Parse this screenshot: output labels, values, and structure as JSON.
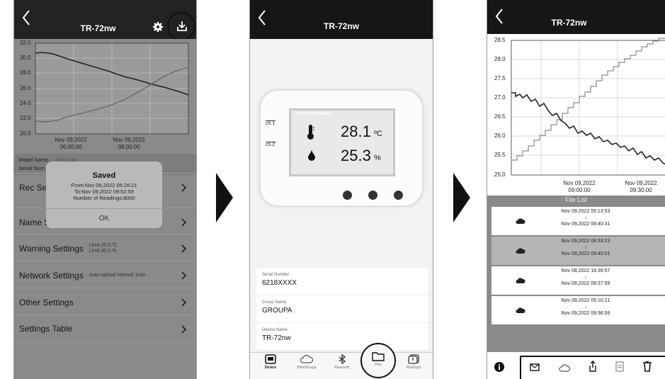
{
  "panel1": {
    "title": "TR-72nw",
    "icons": {
      "back": "chevron-left-icon",
      "settings": "gear-icon",
      "download": "download-icon"
    },
    "y_ticks": [
      "32.0",
      "30.0",
      "28.0",
      "26.0",
      "24.0",
      "22.0",
      "20.0"
    ],
    "x_labels": [
      {
        "date": "Nov 09,2022",
        "time": "06:00:00"
      },
      {
        "date": "Nov 09,2022",
        "time": "08:00:00"
      }
    ],
    "model_name_label": "Model Name",
    "model_name_value": "TR-72nw",
    "serial_label": "Serial Num",
    "dialog": {
      "title": "Saved",
      "line1": "From:Nov 09,2022 05:26:21",
      "line2": "To:Nov 09,2022 09:52:59",
      "line3": "Number of Readings:8000",
      "ok": "OK"
    },
    "settings": [
      {
        "label": "Rec Sett",
        "sub1": "",
        "sub2": ""
      },
      {
        "label": "Name Se",
        "sub1": "",
        "sub2": ""
      },
      {
        "label": "Warning Settings",
        "sub1": "Limit:20.0 ºC",
        "sub2": "Limit:30.0 %"
      },
      {
        "label": "Network Settings",
        "sub1": "Auto-upload Interval 1min",
        "sub2": ""
      },
      {
        "label": "Other Settings",
        "sub1": "",
        "sub2": ""
      },
      {
        "label": "Settings Table",
        "sub1": "",
        "sub2": ""
      }
    ]
  },
  "panel2": {
    "title": "TR-72nw",
    "device_brand": "Thermo Recorder",
    "ch1": "ch.1",
    "ch2": "ch.2",
    "temp_value": "28.1",
    "temp_unit": "ºC",
    "hum_value": "25.3",
    "hum_unit": "%",
    "fields": [
      {
        "label": "Serial Number",
        "value": "6218XXXX"
      },
      {
        "label": "Group Name",
        "value": "GROUPA"
      },
      {
        "label": "Device Name",
        "value": "TR-72nw"
      }
    ],
    "tabs": [
      "Device",
      "WebStorage",
      "Bluetooth",
      "Files",
      "Warnings"
    ]
  },
  "panel3": {
    "title": "TR-72nw",
    "y_ticks": [
      "28.5",
      "28.0",
      "27.5",
      "27.0",
      "26.5",
      "26.0",
      "25.5",
      "25.0"
    ],
    "x_labels": [
      {
        "date": "Nov 09,2022",
        "time": "09:00:00"
      },
      {
        "date": "Nov 09,2022",
        "time": "09:30:00"
      }
    ],
    "file_list_title": "File List",
    "arrow": "↓",
    "files": [
      {
        "from": "Nov 09,2022 05:13:53",
        "to": "Nov 09,2022 09:40:31",
        "selected": false
      },
      {
        "from": "Nov 09,2022 08:33:23",
        "to": "Nov 09,2022 09:40:01",
        "selected": true
      },
      {
        "from": "Nov 08,2022 16:39:57",
        "to": "Nov 09,2022 09:37:59",
        "selected": false
      },
      {
        "from": "Nov 09,2022 05:10:21",
        "to": "Nov 09,2022 09:36:59",
        "selected": false
      }
    ],
    "toolbar_icons": [
      "info-icon",
      "mail-icon",
      "cloud-icon",
      "share-icon",
      "csv-file-icon",
      "trash-icon"
    ]
  },
  "colors": {
    "topbar": "#161616",
    "overlay": "#8a8a8a",
    "selected_row": "#b5b5b5",
    "line_temp": "#333333",
    "line_hum": "#7a7a7a"
  }
}
